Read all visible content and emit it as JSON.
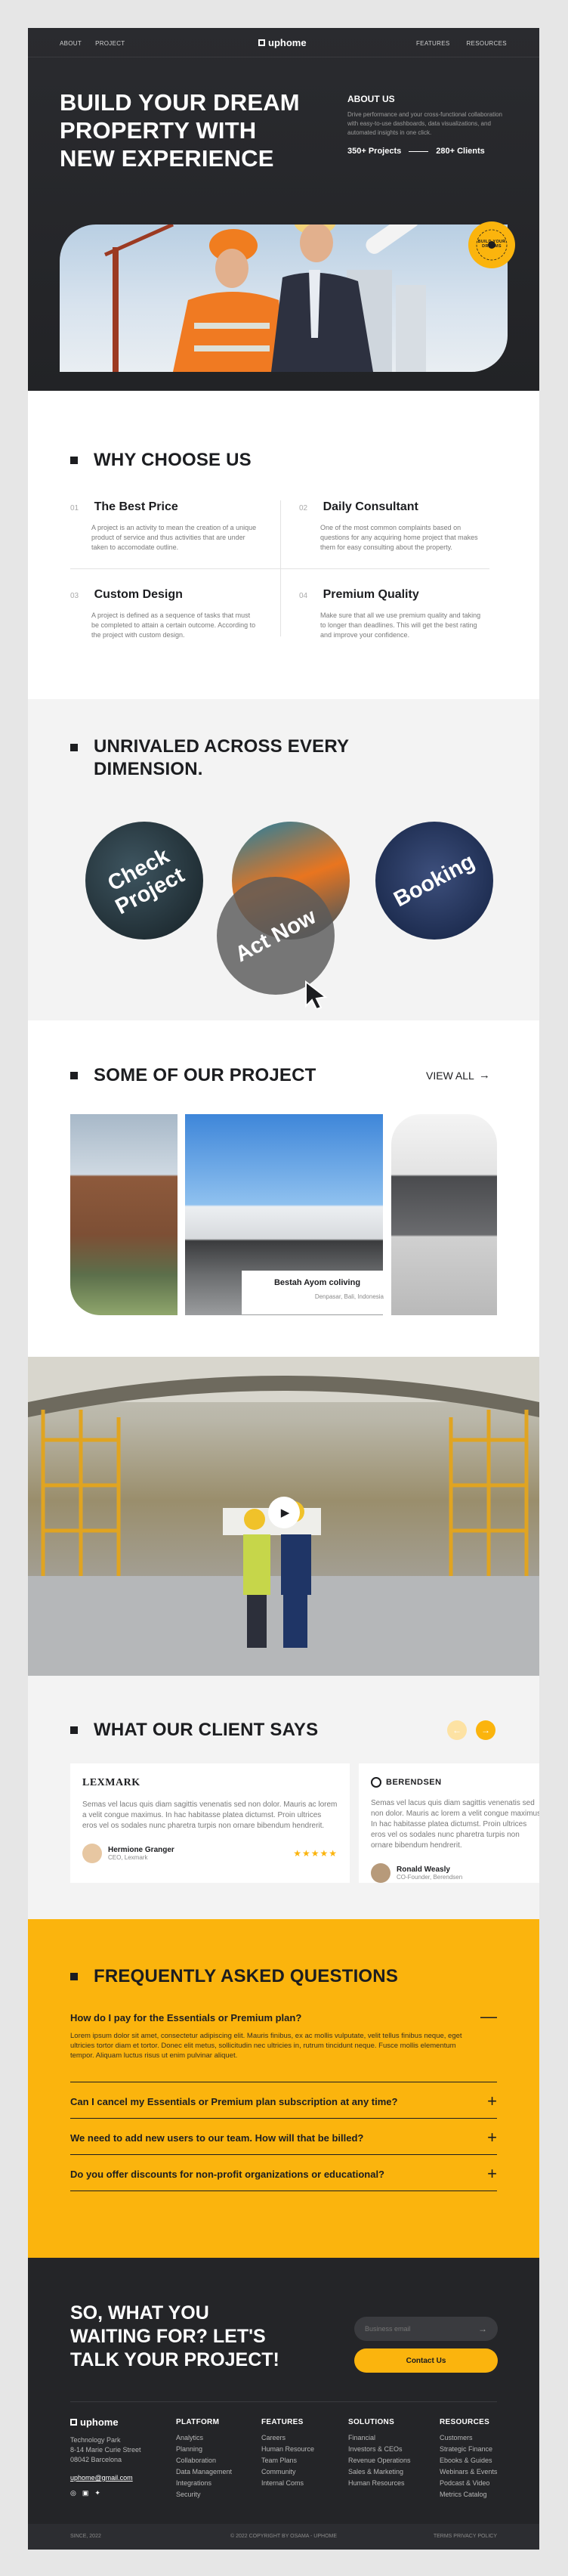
{
  "nav": {
    "left": [
      "ABOUT",
      "PROJECT"
    ],
    "logo": "uphome",
    "right": [
      "FEATURES",
      "RESOURCES"
    ]
  },
  "hero": {
    "title_lines": [
      "BUILD YOUR DREAM",
      "PROPERTY WITH",
      "NEW EXPERIENCE"
    ],
    "about_heading": "ABOUT US",
    "about_text": "Drive performance and your cross-functional collaboration with easy-to-use dashboards, data visualizations, and automated insights in one click.",
    "stat_projects": "350+ Projects",
    "stat_clients": "280+ Clients",
    "badge_text": "BUILD YOUR DREAMS"
  },
  "why": {
    "title": "WHY CHOOSE US",
    "features": [
      {
        "num": "01",
        "title": "The Best Price",
        "text": "A project is an activity to mean the creation of a unique product of service and thus activities that are under taken to accomodate outline."
      },
      {
        "num": "02",
        "title": "Daily Consultant",
        "text": "One of the most common complaints based on questions for any acquiring home project that makes them for easy consulting about the property."
      },
      {
        "num": "03",
        "title": "Custom Design",
        "text": "A project is defined as a sequence of tasks that must be completed to attain a certain outcome. According to the project with custom design."
      },
      {
        "num": "04",
        "title": "Premium Quality",
        "text": "Make sure that all we use premium quality and taking to longer than deadlines. This will get the best rating and improve your confidence."
      }
    ]
  },
  "dimension": {
    "title_lines": [
      "UNRIVALED ACROSS EVERY",
      "DIMENSION."
    ],
    "circles": [
      "Check Project",
      "Act Now",
      "Booking"
    ]
  },
  "projects": {
    "title": "SOME OF OUR PROJECT",
    "view_all": "VIEW ALL",
    "card_title": "Bestah Ayom coliving",
    "card_location": "Denpasar, Bali, Indonesia"
  },
  "testimonials": {
    "title": "WHAT OUR CLIENT SAYS",
    "items": [
      {
        "brand": "LEXMARK",
        "text": "Semas vel lacus quis diam sagittis venenatis sed non dolor. Mauris ac lorem a velit congue maximus. In hac habitasse platea dictumst. Proin ultrices eros vel os sodales nunc pharetra turpis non ornare bibendum hendrerit.",
        "name": "Hermione Granger",
        "role": "CEO, Lexmark",
        "stars": "★★★★★"
      },
      {
        "brand": "BERENDSEN",
        "text": "Semas vel lacus quis diam sagittis venenatis sed non dolor. Mauris ac lorem a velit congue maximus. In hac habitasse platea dictumst. Proin ultrices eros vel os sodales nunc pharetra turpis non ornare bibendum hendrerit.",
        "name": "Ronald Weasly",
        "role": "CO-Founder, Berendsen",
        "stars": ""
      }
    ]
  },
  "faq": {
    "title": "FREQUENTLY ASKED QUESTIONS",
    "items": [
      {
        "q": "How do I pay for the Essentials or Premium plan?",
        "a": "Lorem ipsum dolor sit amet, consectetur adipiscing elit. Mauris finibus, ex ac mollis vulputate, velit tellus finibus neque, eget ultricies tortor diam et tortor. Donec elit metus, sollicitudin nec ultricies in, rutrum tincidunt neque. Fusce mollis elementum tempor. Aliquam luctus risus ut enim pulvinar aliquet.",
        "icon": "—"
      },
      {
        "q": "Can I cancel my Essentials or Premium plan subscription at any time?",
        "a": "",
        "icon": "+"
      },
      {
        "q": "We need to add new users to our team. How will that be billed?",
        "a": "",
        "icon": "+"
      },
      {
        "q": "Do you offer discounts for non-profit organizations or educational?",
        "a": "",
        "icon": "+"
      }
    ]
  },
  "cta": {
    "title_lines": [
      "SO, WHAT YOU",
      "WAITING FOR? LET'S",
      "TALK YOUR PROJECT!"
    ],
    "email_placeholder": "Business email",
    "button": "Contact Us"
  },
  "footer": {
    "logo": "uphome",
    "address": [
      "Technology Park",
      "8-14 Marie Curie Street",
      "08042 Barcelona"
    ],
    "email": "uphome@gmail.com",
    "columns": [
      {
        "title": "PLATFORM",
        "items": [
          "Analytics",
          "Planning",
          "Collaboration",
          "Data Management",
          "Integrations",
          "Security"
        ]
      },
      {
        "title": "FEATURES",
        "items": [
          "Careers",
          "Human Resource",
          "Team Plans",
          "Community",
          "Internal Coms"
        ]
      },
      {
        "title": "SOLUTIONS",
        "items": [
          "Financial",
          "Investors & CEOs",
          "Revenue Operations",
          "Sales & Marketing",
          "Human Resources"
        ]
      },
      {
        "title": "RESOURCES",
        "items": [
          "Customers",
          "Strategic Finance",
          "Ebooks & Guides",
          "Webinars & Events",
          "Podcast & Video",
          "Metrics Catalog"
        ]
      }
    ],
    "bottom_left": "SINCE, 2022",
    "bottom_center": "© 2022 COPYRIGHT BY OSAMA - UPHOME",
    "bottom_right": "TERMS PRIVACY POLICY"
  },
  "colors": {
    "accent": "#fbb40d",
    "dark": "#242528",
    "light_section": "#f3f3f3"
  }
}
